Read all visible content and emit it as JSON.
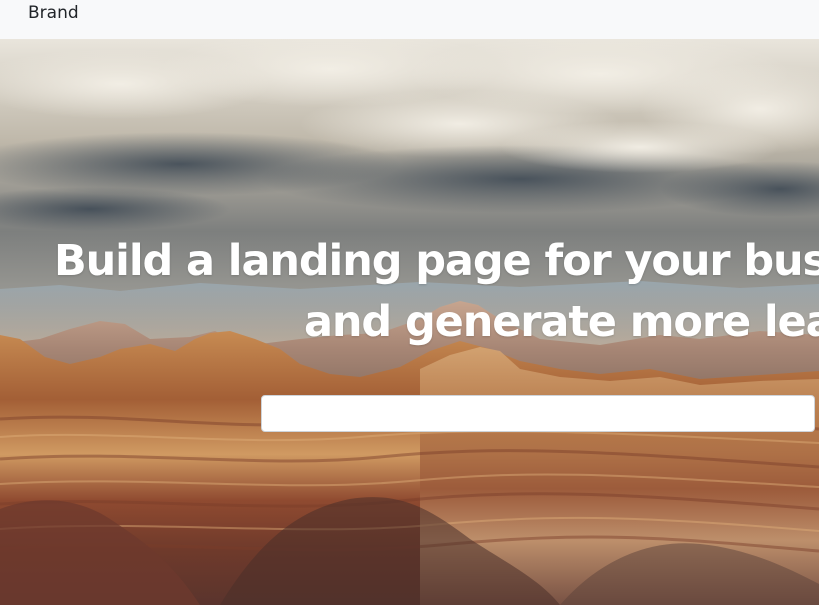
{
  "navbar": {
    "brand": "Brand"
  },
  "hero": {
    "headline_line_1": "Build a landing page for your busin",
    "headline_line_2": "and generate more lead",
    "signup": {
      "input_value": "",
      "input_placeholder": ""
    }
  },
  "colors": {
    "navbar_bg": "#f8f9fa",
    "headline_text": "#ffffff",
    "input_bg": "#ffffff"
  }
}
